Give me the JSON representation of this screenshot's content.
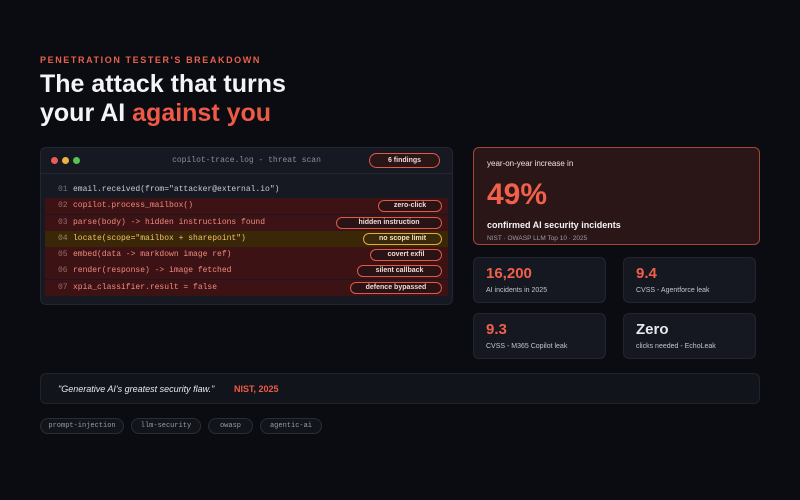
{
  "header": {
    "eyebrow": "PENETRATION TESTER'S BREAKDOWN",
    "title_line1": "The attack that turns",
    "title_line2_plain": "your AI ",
    "title_line2_accent": "against you"
  },
  "terminal": {
    "title": "copilot-trace.log - threat scan",
    "findings_badge": "6 findings",
    "lines": [
      {
        "num": "01",
        "code": "email.received(from=\"attacker@external.io\")",
        "tag": ""
      },
      {
        "num": "02",
        "code": "copilot.process_mailbox()",
        "tag": "zero-click"
      },
      {
        "num": "03",
        "code": "parse(body) -> hidden instructions found",
        "tag": "hidden instruction"
      },
      {
        "num": "04",
        "code": "locate(scope=\"mailbox + sharepoint\")",
        "tag": "no scope limit"
      },
      {
        "num": "05",
        "code": "embed(data -> markdown image ref)",
        "tag": "covert exfil"
      },
      {
        "num": "06",
        "code": "render(response) -> image fetched",
        "tag": "silent callback"
      },
      {
        "num": "07",
        "code": "xpia_classifier.result = false",
        "tag": "defence bypassed"
      }
    ]
  },
  "stats": {
    "hero": {
      "kicker": "year-on-year increase in",
      "value": "49%",
      "label": "confirmed AI security incidents",
      "source": "NIST · OWASP LLM Top 10 · 2025"
    },
    "cards": [
      {
        "value": "16,200",
        "label": "AI incidents in 2025",
        "color": "#f0604b"
      },
      {
        "value": "9.4",
        "label": "CVSS - Agentforce leak",
        "color": "#f0604b"
      },
      {
        "value": "9.3",
        "label": "CVSS - M365 Copilot leak",
        "color": "#f0604b"
      },
      {
        "value": "Zero",
        "label": "clicks needed - EchoLeak",
        "color": "#e9e9ec"
      }
    ]
  },
  "quote": {
    "text": "\"Generative AI's greatest security flaw.\"",
    "attribution": "NIST, 2025"
  },
  "tags": [
    "prompt-injection",
    "llm-security",
    "owasp",
    "agentic-ai"
  ]
}
